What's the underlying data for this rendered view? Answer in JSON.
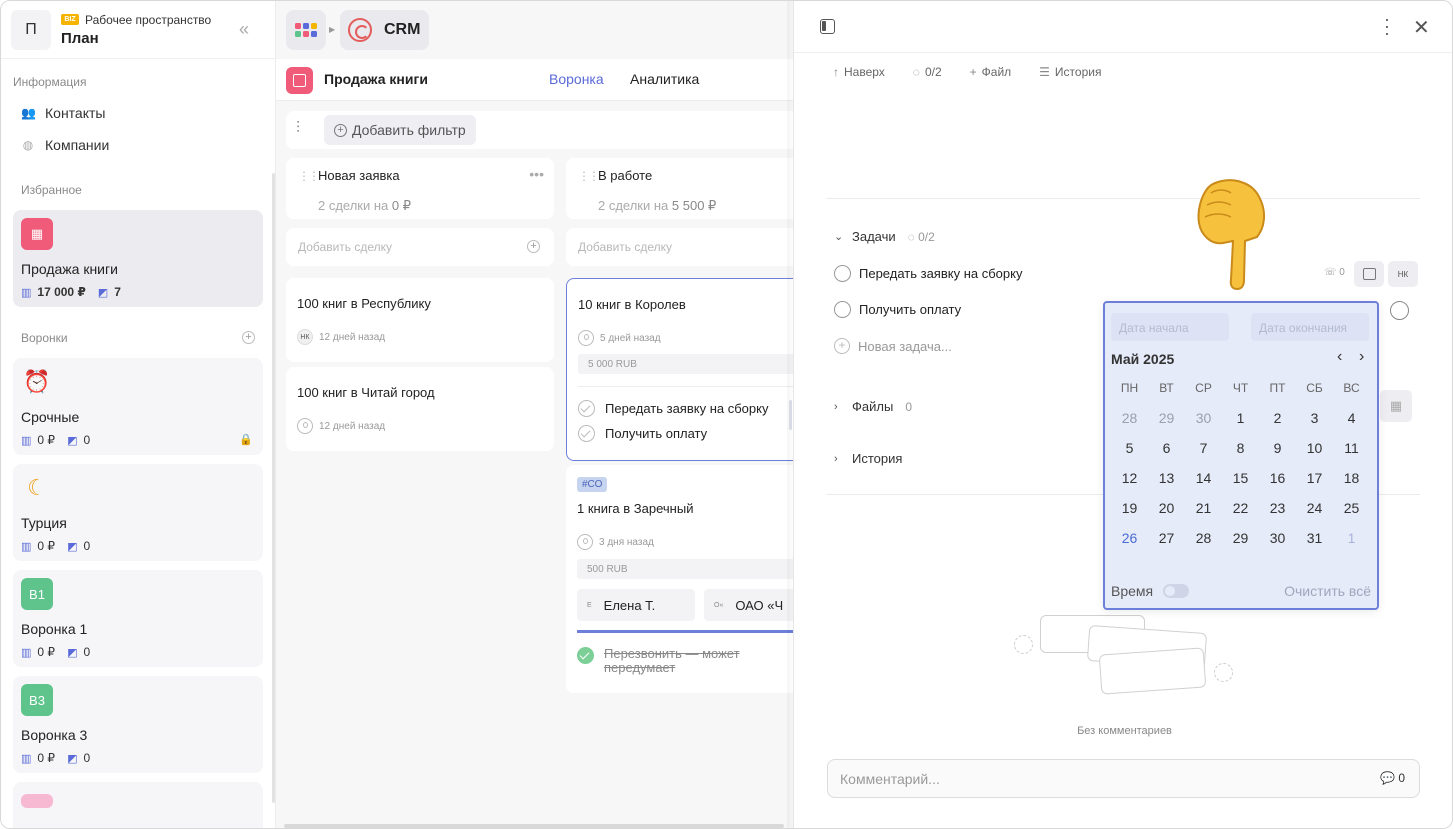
{
  "workspace": {
    "avatar": "П",
    "badge": "BIZ",
    "subtitle": "Рабочее пространство",
    "name": "План"
  },
  "sidebar": {
    "info_label": "Информация",
    "contacts": "Контакты",
    "companies": "Компании",
    "favorites_label": "Избранное",
    "favorite": {
      "title": "Продажа книги",
      "sum": "17 000 ₽",
      "count": "7"
    },
    "funnels_label": "Воронки",
    "funnels": [
      {
        "icon": "alarm-clock",
        "title": "Срочные",
        "sum": "0 ₽",
        "count": "0",
        "locked": true
      },
      {
        "icon": "crescent-moon",
        "title": "Турция",
        "sum": "0 ₽",
        "count": "0"
      },
      {
        "icon": "В1",
        "title": "Воронка 1",
        "sum": "0 ₽",
        "count": "0"
      },
      {
        "icon": "В3",
        "title": "Воронка 3",
        "sum": "0 ₽",
        "count": "0"
      }
    ]
  },
  "topbar": {
    "app": "CRM"
  },
  "funnel": {
    "title": "Продажа книги",
    "tabs": [
      "Воронка",
      "Аналитика"
    ],
    "add_filter": "Добавить фильтр",
    "add_deal": "Добавить сделку",
    "columns": [
      {
        "title": "Новая заявка",
        "summary_pre": "2 сделки на",
        "summary_val": "0 ₽"
      },
      {
        "title": "В работе",
        "summary_pre": "2 сделки на",
        "summary_val": "5 500 ₽"
      }
    ],
    "deals": {
      "d1": {
        "title": "100 книг в Республику",
        "avatar": "НК",
        "time": "12 дней назад"
      },
      "d2": {
        "title": "100 книг в Читай город",
        "time": "12 дней назад"
      },
      "d3": {
        "title": "10 книг в Королев",
        "time": "5 дней назад",
        "amount": "5 000 RUB",
        "tasks": [
          "Передать заявку на сборку",
          "Получить оплату"
        ]
      },
      "d4": {
        "tag": "#СО",
        "title": "1 книга в Заречный",
        "time": "3 дня назад",
        "amount": "500 RUB",
        "person": "Елена Т.",
        "person_av": "Е",
        "company": "ОАО «Ч",
        "company_av": "О«",
        "done_task": "Перезвонить — может передумает"
      }
    }
  },
  "panel": {
    "toolbar": {
      "up": "Наверх",
      "progress": "0/2",
      "file": "Файл",
      "history": "История"
    },
    "tasks_label": "Задачи",
    "tasks_count": "0/2",
    "tasks": [
      "Передать заявку на сборку",
      "Получить оплату"
    ],
    "new_task": "Новая задача...",
    "phone_count": "0",
    "assignee": "НК",
    "files_label": "Файлы",
    "files_count": "0",
    "history_label": "История",
    "no_comments": "Без комментариев",
    "comment_placeholder": "Комментарий...",
    "comment_count": "0"
  },
  "datepicker": {
    "start_placeholder": "Дата начала",
    "end_placeholder": "Дата окончания",
    "month": "Май 2025",
    "weekdays": [
      "ПН",
      "ВТ",
      "СР",
      "ЧТ",
      "ПТ",
      "СБ",
      "ВС"
    ],
    "days": [
      "28",
      "29",
      "30",
      "1",
      "2",
      "3",
      "4",
      "5",
      "6",
      "7",
      "8",
      "9",
      "10",
      "11",
      "12",
      "13",
      "14",
      "15",
      "16",
      "17",
      "18",
      "19",
      "20",
      "21",
      "22",
      "23",
      "24",
      "25",
      "26",
      "27",
      "28",
      "29",
      "30",
      "31",
      "1"
    ],
    "today": "26",
    "time_label": "Время",
    "clear_label": "Очистить всё"
  },
  "colors": {
    "accent": "#5a6ad8",
    "funnel_pink": "#ef5b78",
    "green": "#5fc48c",
    "picker_border": "#6c80d9"
  }
}
